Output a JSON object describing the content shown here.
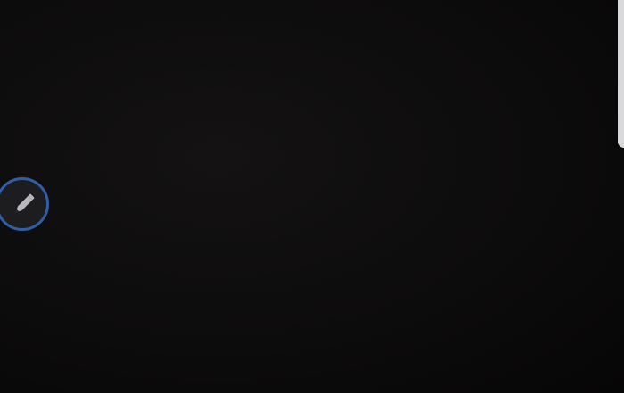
{
  "screen": {
    "background_color": "#0b0a0a"
  },
  "edge_panel": {
    "handle_color": "#d9d9dc"
  },
  "floating_button": {
    "icon": "pen-icon",
    "ring_color": "#2f5fa8",
    "fill_color": "#1d1c1f",
    "icon_color": "#b8b8bc"
  }
}
